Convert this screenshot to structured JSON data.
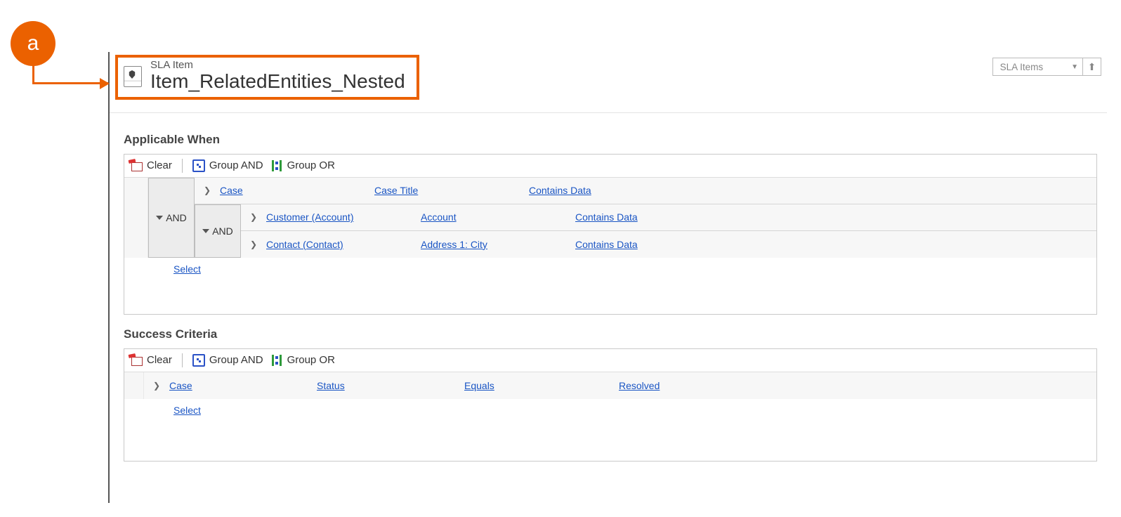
{
  "callout": {
    "letter": "a"
  },
  "header": {
    "entity_label": "SLA Item",
    "record_title": "Item_RelatedEntities_Nested",
    "nav_select": "SLA Items"
  },
  "sections": {
    "applicable_when": {
      "title": "Applicable When",
      "toolbar": {
        "clear": "Clear",
        "group_and": "Group AND",
        "group_or": "Group OR"
      },
      "outer_group": "AND",
      "rows": [
        {
          "entity": "Case",
          "field": "Case Title",
          "operator": "Contains Data"
        }
      ],
      "nested_group": "AND",
      "nested_rows": [
        {
          "entity": "Customer (Account)",
          "field": "Account",
          "operator": "Contains Data"
        },
        {
          "entity": "Contact (Contact)",
          "field": "Address 1: City",
          "operator": "Contains Data"
        }
      ],
      "select_label": "Select"
    },
    "success_criteria": {
      "title": "Success Criteria",
      "toolbar": {
        "clear": "Clear",
        "group_and": "Group AND",
        "group_or": "Group OR"
      },
      "rows": [
        {
          "entity": "Case",
          "field": "Status",
          "operator": "Equals",
          "value": "Resolved"
        }
      ],
      "select_label": "Select"
    }
  }
}
